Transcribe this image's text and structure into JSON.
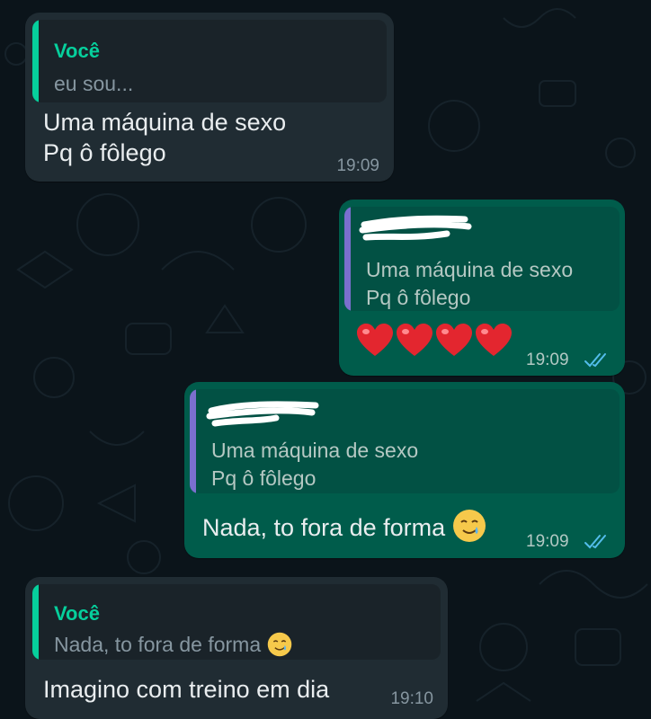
{
  "colors": {
    "background": "#0b141a",
    "incoming_bubble": "#202c33",
    "outgoing_bubble": "#005c4b",
    "quote_bar_green": "#06cf9c",
    "quote_bar_purple": "#7b6fcf",
    "read_tick": "#53bdeb",
    "heart": "#e3262f"
  },
  "messages": [
    {
      "direction": "incoming",
      "quote_name": "Você",
      "quote_text": "eu sou...",
      "text": "Uma máquina de sexo\nPq ô fôlego",
      "time": "19:09"
    },
    {
      "direction": "outgoing",
      "quote_name_redacted": true,
      "quote_text": "Uma máquina de sexo\nPq ô fôlego",
      "text": "❤️❤️❤️❤️",
      "time": "19:09",
      "status_icon": "double-check-read-icon"
    },
    {
      "direction": "outgoing",
      "quote_name_redacted": true,
      "quote_text": "Uma máquina de sexo\nPq ô fôlego",
      "text": "Nada, to fora de forma",
      "emoji": "crying-smile-emoji",
      "time": "19:09",
      "status_icon": "double-check-read-icon"
    },
    {
      "direction": "incoming",
      "quote_name": "Você",
      "quote_text": "Nada, to fora de forma",
      "quote_emoji": "crying-smile-emoji",
      "text": "Imagino com treino em dia",
      "time": "19:10"
    }
  ]
}
